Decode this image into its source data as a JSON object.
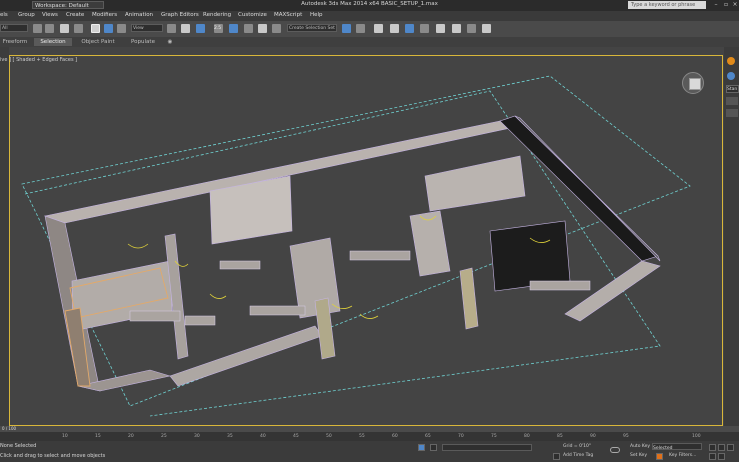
{
  "title_bar": {
    "workspace": "Workspace: Default",
    "app_title": "Autodesk 3ds Max 2014 x64     BASIC_SETUP_1.max",
    "search_placeholder": "Type a keyword or phrase"
  },
  "menu": [
    "els",
    "Group",
    "Views",
    "Create",
    "Modifiers",
    "Animation",
    "Graph Editors",
    "Rendering",
    "Customize",
    "MAXScript",
    "Help"
  ],
  "toolbar": {
    "selection_filter": "All",
    "reference_coord": "View",
    "named_selection": "Create Selection Set",
    "snap_label": "2.5"
  },
  "ribbon_tabs": [
    "Freeform",
    "Selection",
    "Object Paint",
    "Populate"
  ],
  "viewport": {
    "label": "ive ] [ Shaded + Edged Faces ]"
  },
  "right_panel": {
    "name_field": "Stan"
  },
  "timeline": {
    "frame_counter": "0 / 100",
    "ticks": [
      "10",
      "15",
      "20",
      "25",
      "30",
      "35",
      "40",
      "45",
      "50",
      "55",
      "60",
      "65",
      "70",
      "75",
      "80",
      "85",
      "90",
      "95",
      "100"
    ]
  },
  "status": {
    "selection": "None Selected",
    "prompt": "Click and drag to select and move objects",
    "grid": "Grid = 0'10\"",
    "add_time_tag": "Add Time Tag",
    "auto_key": "Auto Key",
    "set_key": "Set Key",
    "selected_dropdown": "Selected",
    "key_filters": "Key Filters..."
  },
  "colors": {
    "viewport_border": "#d9b73a",
    "accent_blue": "#4f87c9",
    "autokey_orange": "#e0701a"
  }
}
